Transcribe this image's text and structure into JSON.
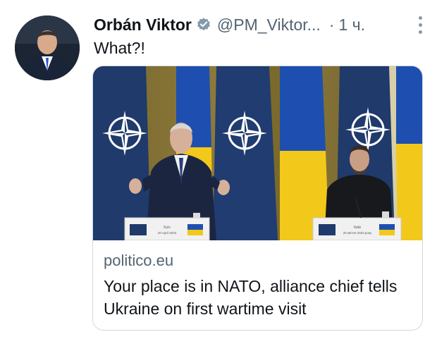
{
  "tweet": {
    "author_name": "Orbán Viktor",
    "handle": "@PM_Viktor...",
    "separator": "·",
    "time": "1 ч.",
    "text": "What?!",
    "verified_icon": "verified-badge-icon",
    "more_icon": "more-vertical-icon"
  },
  "card": {
    "image": {
      "placard_left_city": "Kyiv",
      "placard_left_date": "20 April 2023",
      "placard_right_city": "Київ",
      "placard_right_date": "20 квітня 2023 року"
    },
    "domain": "politico.eu",
    "title": "Your place is in NATO, alliance chief tells Ukraine on first wartime visit"
  },
  "colors": {
    "text_primary": "#0f1419",
    "text_secondary": "#536471",
    "verified": "#829aab",
    "nato_blue": "#1f3a6b",
    "ukraine_blue": "#1e4fb0",
    "ukraine_yellow": "#f2c81b"
  }
}
